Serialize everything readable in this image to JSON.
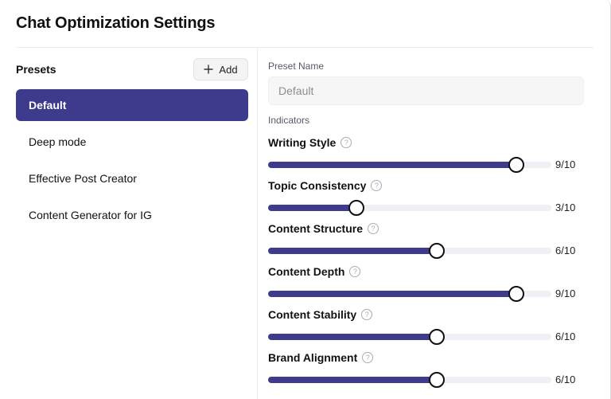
{
  "dialog": {
    "title": "Chat Optimization Settings"
  },
  "presets": {
    "label": "Presets",
    "add_label": "Add",
    "items": [
      {
        "label": "Default",
        "active": true
      },
      {
        "label": "Deep mode",
        "active": false
      },
      {
        "label": "Effective Post Creator",
        "active": false
      },
      {
        "label": "Content Generator for IG",
        "active": false
      }
    ]
  },
  "form": {
    "preset_name_label": "Preset Name",
    "preset_name_placeholder": "Default",
    "indicators_label": "Indicators",
    "indicators": [
      {
        "name": "Writing Style",
        "value": 9,
        "max": 10,
        "display": "9/10"
      },
      {
        "name": "Topic Consistency",
        "value": 3,
        "max": 10,
        "display": "3/10"
      },
      {
        "name": "Content Structure",
        "value": 6,
        "max": 10,
        "display": "6/10"
      },
      {
        "name": "Content Depth",
        "value": 9,
        "max": 10,
        "display": "9/10"
      },
      {
        "name": "Content Stability",
        "value": 6,
        "max": 10,
        "display": "6/10"
      },
      {
        "name": "Brand Alignment",
        "value": 6,
        "max": 10,
        "display": "6/10"
      }
    ]
  },
  "icons": {
    "add": "plus-icon",
    "help": "question-circle-icon"
  },
  "colors": {
    "accent": "#3e3a8c",
    "track": "#eef0f5"
  }
}
